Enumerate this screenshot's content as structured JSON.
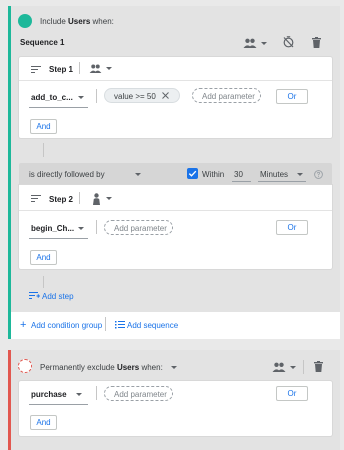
{
  "include_block": {
    "header_prefix": "Include",
    "header_users": "Users",
    "header_suffix": "when:",
    "sequence_title": "Sequence 1",
    "colors": {
      "accent": "#1db89a"
    }
  },
  "step1": {
    "label": "Step 1",
    "event": "add_to_c...",
    "condition": "value >= 50",
    "add_parameter": "Add parameter",
    "or_label": "Or",
    "and_label": "And"
  },
  "followed": {
    "relation": "is directly followed by",
    "within_label": "Within",
    "within_value": "30",
    "unit": "Minutes"
  },
  "step2": {
    "label": "Step 2",
    "event": "begin_Ch...",
    "add_parameter": "Add parameter",
    "or_label": "Or",
    "and_label": "And"
  },
  "add_step": "Add step",
  "add_condition_group": "Add condition group",
  "add_sequence": "Add sequence",
  "exclude_block": {
    "header_prefix": "Permanently exclude",
    "header_users": "Users",
    "header_suffix": "when:",
    "event": "purchase",
    "add_parameter": "Add parameter",
    "or_label": "Or",
    "and_label": "And",
    "colors": {
      "accent": "#e25850"
    }
  }
}
